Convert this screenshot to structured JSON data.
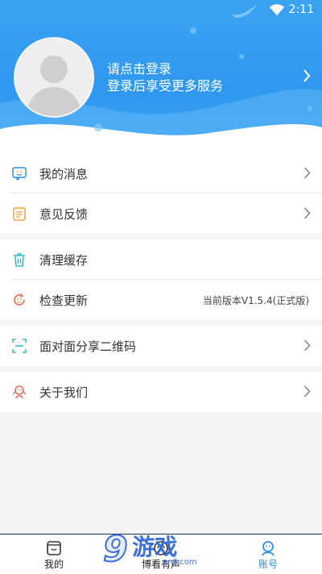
{
  "status_bar": {
    "time": "2:11"
  },
  "profile": {
    "login_prompt": "请点击登录",
    "login_hint": "登录后享受更多服务"
  },
  "menu_group1": [
    {
      "label": "我的消息"
    },
    {
      "label": "意见反馈"
    }
  ],
  "menu_group2": [
    {
      "label": "清理缓存"
    },
    {
      "label": "检查更新",
      "value": "当前版本V1.5.4(正式版)"
    }
  ],
  "menu_group3": [
    {
      "label": "面对面分享二维码"
    }
  ],
  "menu_group4": [
    {
      "label": "关于我们"
    }
  ],
  "tabs": [
    {
      "label": "我的",
      "icon": "book-icon"
    },
    {
      "label": "博看有声",
      "icon": "headphones-icon"
    },
    {
      "label": "账号",
      "icon": "user-icon",
      "active": true
    }
  ],
  "watermark": {
    "logo": "9",
    "text": "游戏",
    "url": "anji.com"
  },
  "colors": {
    "header_blue": "#3aa3f2",
    "accent": "#2e8ee8",
    "orange": "#f2a23a",
    "teal": "#3bb7c9",
    "red": "#e46a5a"
  }
}
